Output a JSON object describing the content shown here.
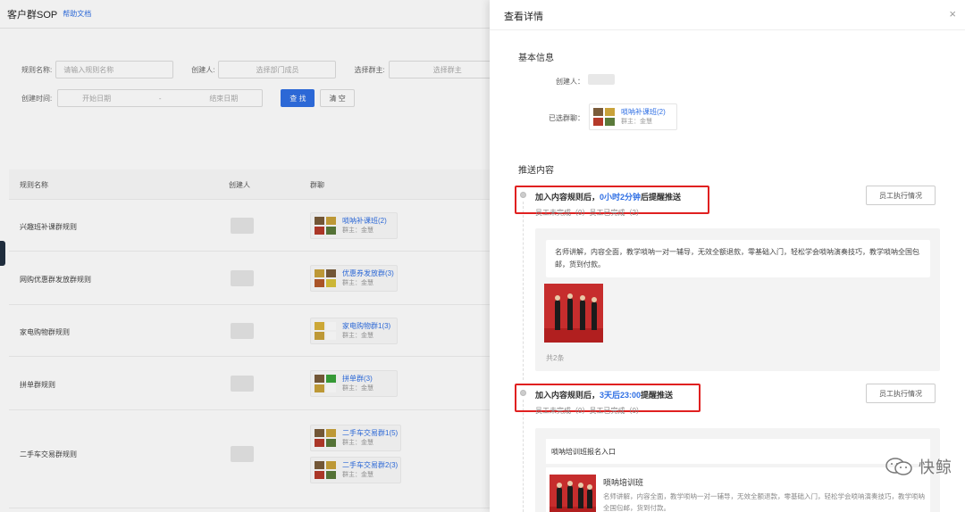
{
  "header": {
    "title": "客户群SOP",
    "help_link": "帮助文档"
  },
  "filter": {
    "rule_name_label": "规则名称:",
    "rule_name_placeholder": "请输入规则名称",
    "creator_label": "创建人:",
    "creator_value": "选择部门成员",
    "group_owner_label": "选择群主:",
    "group_owner_value": "选择群主",
    "created_time_label": "创建时间:",
    "start_date": "开始日期",
    "to": "-",
    "end_date": "结束日期",
    "search_button": "查 找",
    "clear_button": "清 空"
  },
  "table": {
    "columns": [
      "规则名称",
      "创建人",
      "群聊"
    ],
    "rows": [
      {
        "name": "兴趣班补课群规则",
        "groups": [
          {
            "name": "唢呐补课班(2)",
            "owner": "群主：金慧"
          }
        ]
      },
      {
        "name": "网购优惠群发放群规则",
        "groups": [
          {
            "name": "优惠券发放群(3)",
            "owner": "群主：金慧"
          }
        ]
      },
      {
        "name": "家电购物群规则",
        "groups": [
          {
            "name": "家电购物群1(3)",
            "owner": "群主：金慧"
          }
        ]
      },
      {
        "name": "拼单群规则",
        "groups": [
          {
            "name": "拼单群(3)",
            "owner": "群主：金慧"
          }
        ]
      },
      {
        "name": "二手车交易群规则",
        "groups": [
          {
            "name": "二手车交易群1(5)",
            "owner": "群主：金慧"
          },
          {
            "name": "二手车交易群2(3)",
            "owner": "群主：金慧"
          }
        ]
      }
    ]
  },
  "drawer": {
    "title": "查看详情",
    "close_icon": "×",
    "basic_info_title": "基本信息",
    "creator_label": "创建人：",
    "selected_groups_label": "已选群聊：",
    "selected_group": {
      "name": "唢呐补课班(2)",
      "owner": "群主：金慧"
    },
    "push_content_title": "推送内容",
    "rules": [
      {
        "prefix": "加入内容规则后，",
        "highlight": "0小时2分钟",
        "suffix": "后提醒推送",
        "status": "员工未完成（0）员工已完成（2）",
        "exec_button": "员工执行情况",
        "message": "名师讲解，内容全面，教学唢呐一对一辅导，无效全额退款，零基础入门，轻松学会唢呐演奏技巧，教学唢呐全国包邮，货到付款。",
        "count": "共2条"
      },
      {
        "prefix": "加入内容规则后，",
        "highlight": "3天后23:00",
        "suffix": "提醒推送",
        "status": "员工未完成（0）员工已完成（0）",
        "exec_button": "员工执行情况",
        "link_title": "唢呐培训班报名入口",
        "link_card_title": "唢呐培训班",
        "link_card_desc": "名师讲解，内容全面，教学唢呐一对一辅导，无效全额退款，零基础入门，轻松学会唢呐演奏技巧，教学唢呐全国包邮，货到付款。"
      }
    ]
  },
  "watermark": {
    "text": "快鲸"
  },
  "colors": {
    "primary": "#2f6fe4",
    "highlight_box": "#e02020"
  }
}
